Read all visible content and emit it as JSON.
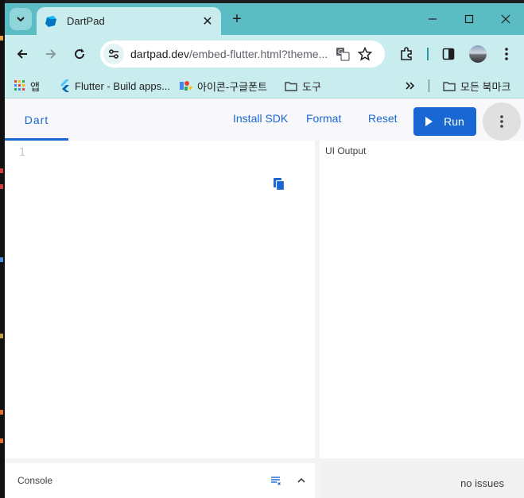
{
  "browser": {
    "tab": {
      "title": "DartPad"
    },
    "address_bar": {
      "host": "dartpad.dev",
      "path": "/embed-flutter.html?theme..."
    },
    "bookmarks": [
      {
        "label": "앱",
        "icon": "apps-grid-icon"
      },
      {
        "label": "Flutter - Build apps...",
        "icon": "flutter-logo-icon"
      },
      {
        "label": "아이콘-구글폰트",
        "icon": "google-fonts-icon"
      },
      {
        "label": "도구",
        "icon": "folder-icon"
      },
      {
        "label": "모든 북마크",
        "icon": "folder-icon"
      }
    ]
  },
  "dartpad": {
    "active_tab": "Dart",
    "actions": {
      "install_sdk": "Install SDK",
      "format": "Format",
      "reset": "Reset",
      "run": "Run"
    },
    "editor": {
      "line_number": "1"
    },
    "output": {
      "label": "UI Output"
    },
    "console": {
      "label": "Console"
    },
    "status": {
      "issues": "no issues"
    }
  },
  "colors": {
    "accent": "#1967d2",
    "chrome_titlebar": "#5bbcc3",
    "chrome_toolbar": "#c9ecee"
  }
}
